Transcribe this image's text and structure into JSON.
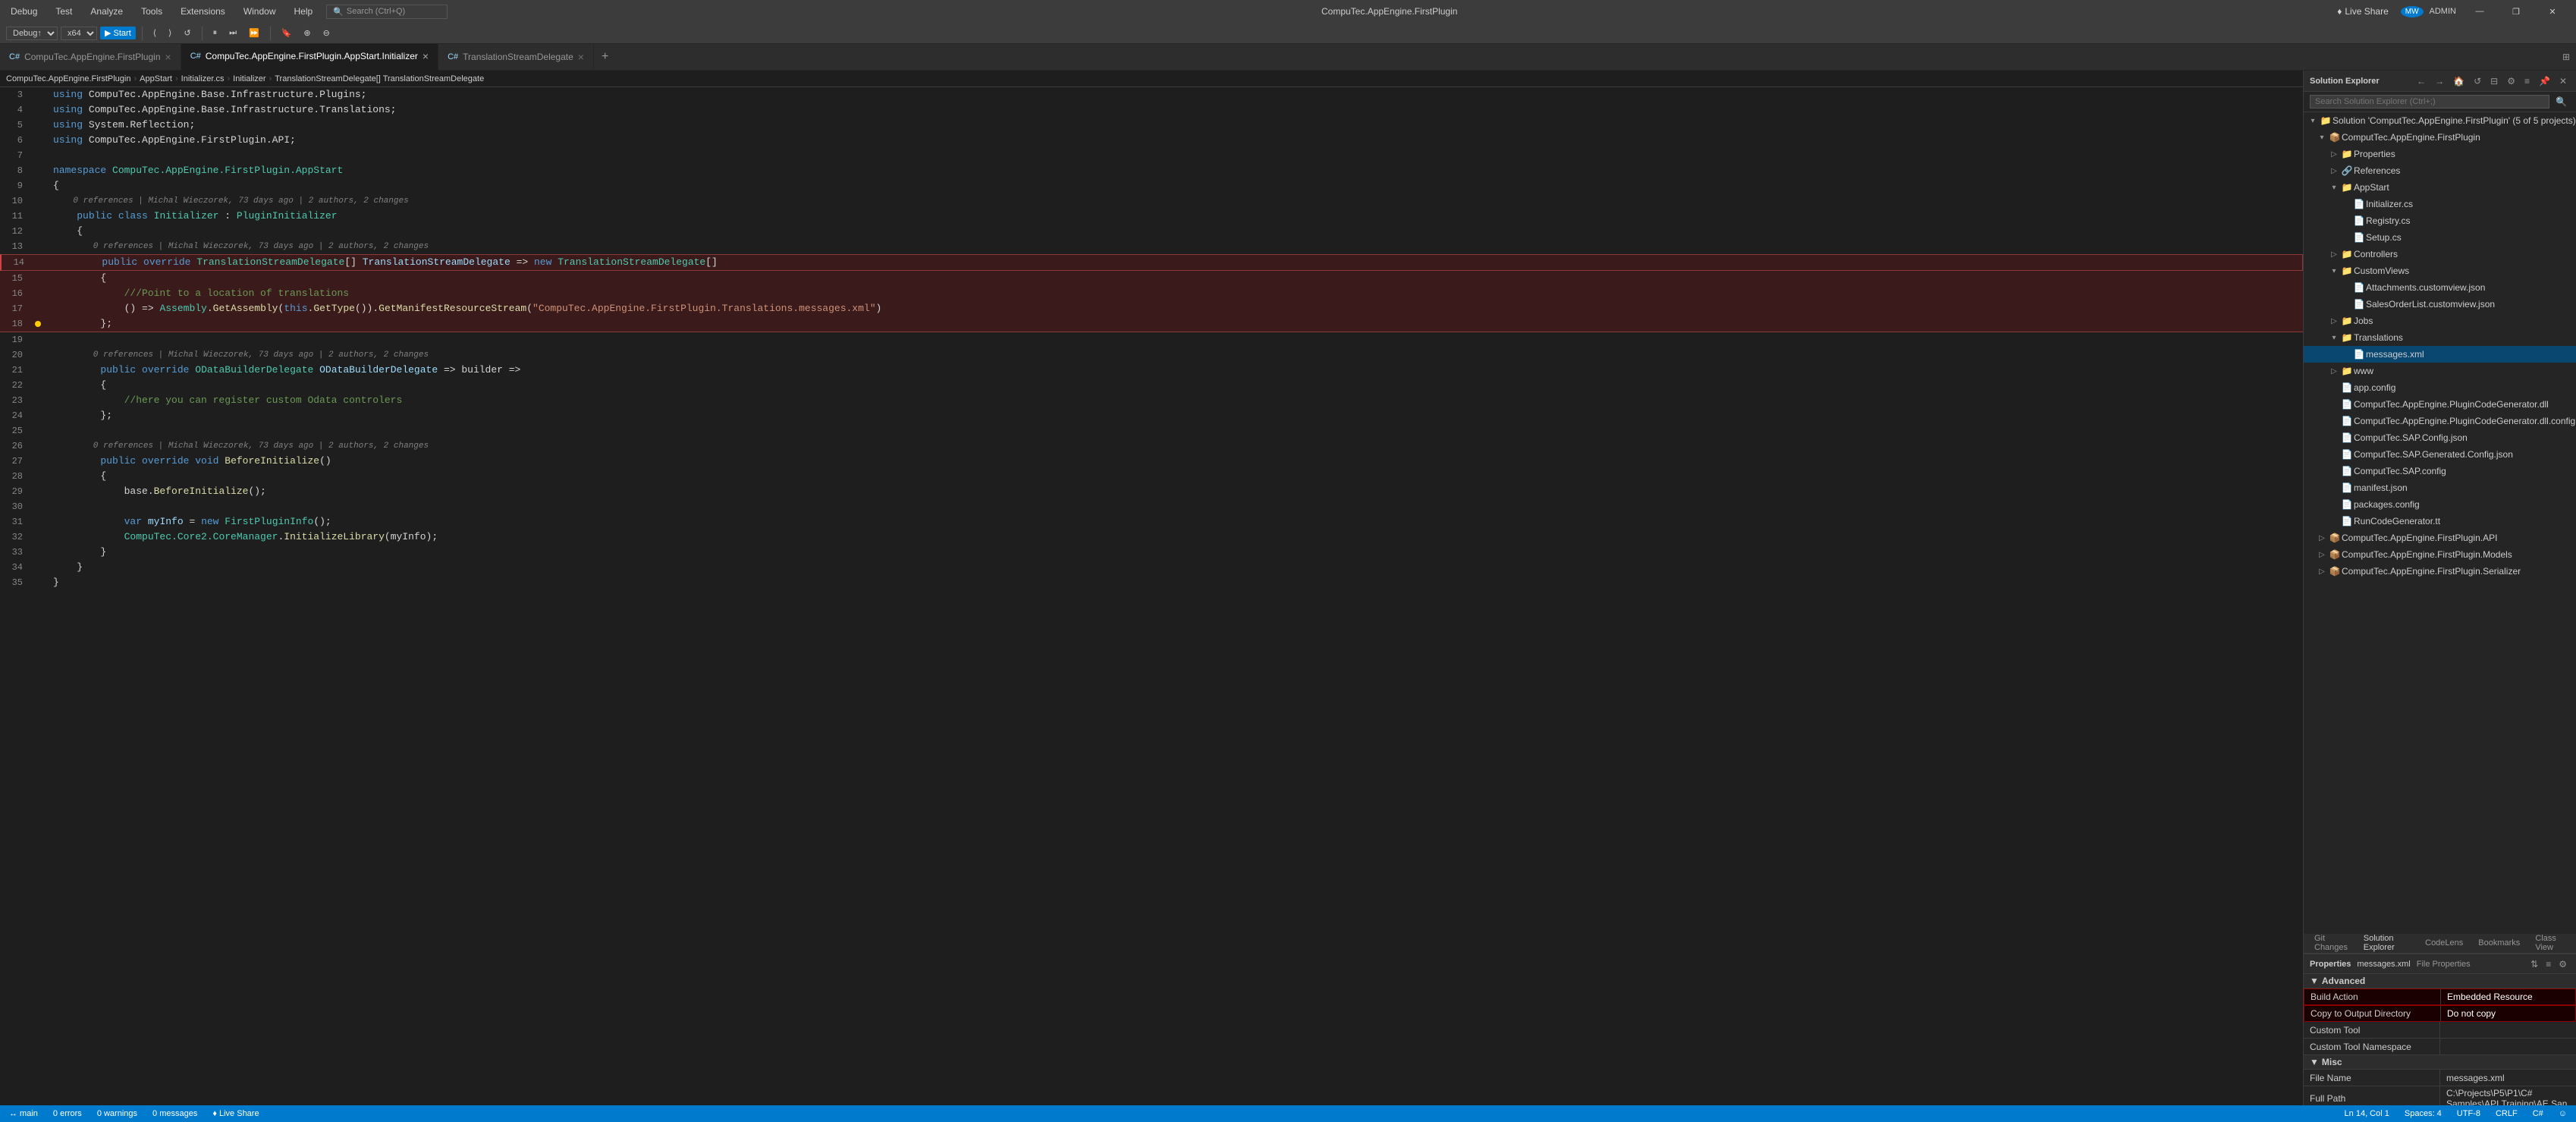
{
  "titleBar": {
    "menus": [
      "Debug",
      "Test",
      "Analyze",
      "Tools",
      "Extensions",
      "Window",
      "Help"
    ],
    "searchPlaceholder": "Search (Ctrl+Q)",
    "centerTitle": "CompuTec.AppEngine.FirstPlugin",
    "userInitials": "MW",
    "adminLabel": "ADMIN",
    "liveShareLabel": "Live Share",
    "winControls": [
      "—",
      "❐",
      "✕"
    ]
  },
  "toolbar": {
    "debugConfig": "Debug↑",
    "platform": "x64",
    "startLabel": "▶ Start",
    "searchPlaceholder": "Search (Ctrl+Q)"
  },
  "tabs": [
    {
      "label": "CompuTec.AppEngine.FirstPlugin",
      "icon": "C#",
      "active": false,
      "closeable": true
    },
    {
      "label": "CompuTec.AppEngine.FirstPlugin.AppStart.Initializer",
      "icon": "C#",
      "active": true,
      "closeable": true
    },
    {
      "label": "TranslationStreamDelegate",
      "icon": "C#",
      "active": false,
      "closeable": true
    }
  ],
  "breadcrumb": {
    "parts": [
      "CompuTec.AppEngine.FirstPlugin",
      "AppStart",
      "Initializer.cs",
      "Initializer",
      "TranslationStreamDelegate[]TranslationStreamDelegate"
    ]
  },
  "codeLines": [
    {
      "num": "3",
      "content": "using CompuTec.AppEngine.Base.Infrastructure.Plugins;",
      "type": "normal"
    },
    {
      "num": "4",
      "content": "using CompuTec.AppEngine.Base.Infrastructure.Translations;",
      "type": "normal"
    },
    {
      "num": "5",
      "content": "using System.Reflection;",
      "type": "normal"
    },
    {
      "num": "6",
      "content": "using CompuTec.AppEngine.FirstPlugin.API;",
      "type": "normal"
    },
    {
      "num": "7",
      "content": "",
      "type": "normal"
    },
    {
      "num": "8",
      "content": "namespace CompuTec.AppEngine.FirstPlugin.AppStart",
      "type": "normal"
    },
    {
      "num": "9",
      "content": "{",
      "type": "normal"
    },
    {
      "num": "10",
      "content": "    0 references | Michal Wieczorek, 73 days ago | 2 authors, 2 changes",
      "type": "refinfo"
    },
    {
      "num": "11",
      "content": "    public class Initializer : PluginInitializer",
      "type": "normal"
    },
    {
      "num": "12",
      "content": "    {",
      "type": "normal"
    },
    {
      "num": "13",
      "content": "        0 references | Michal Wieczorek, 73 days ago | 2 authors, 2 changes",
      "type": "refinfo"
    },
    {
      "num": "14",
      "content": "        public override TranslationStreamDelegate[] TranslationStreamDelegate => new TranslationStreamDelegate[]",
      "type": "highlight"
    },
    {
      "num": "15",
      "content": "        {",
      "type": "highlight"
    },
    {
      "num": "16",
      "content": "            ///Point to a location of translations",
      "type": "highlight_comment"
    },
    {
      "num": "17",
      "content": "            () => Assembly.GetAssembly(this.GetType()).GetManifestResourceStream(\"CompuTec.AppEngine.FirstPlugin.Translations.messages.xml\")",
      "type": "highlight"
    },
    {
      "num": "18",
      "content": "        };",
      "type": "highlight"
    },
    {
      "num": "19",
      "content": "",
      "type": "normal"
    },
    {
      "num": "20",
      "content": "        0 references | Michal Wieczorek, 73 days ago | 2 authors, 2 changes",
      "type": "refinfo"
    },
    {
      "num": "21",
      "content": "        public override ODataBuilderDelegate ODataBuilderDelegate => builder =>",
      "type": "normal"
    },
    {
      "num": "22",
      "content": "        {",
      "type": "normal"
    },
    {
      "num": "23",
      "content": "            //here you can register custom Odata controlers",
      "type": "comment"
    },
    {
      "num": "24",
      "content": "        };",
      "type": "normal"
    },
    {
      "num": "25",
      "content": "",
      "type": "normal"
    },
    {
      "num": "26",
      "content": "        0 references | Michal Wieczorek, 73 days ago | 2 authors, 2 changes",
      "type": "refinfo"
    },
    {
      "num": "27",
      "content": "        public override void BeforeInitialize()",
      "type": "normal"
    },
    {
      "num": "28",
      "content": "        {",
      "type": "normal"
    },
    {
      "num": "29",
      "content": "            base.BeforeInitialize();",
      "type": "normal"
    },
    {
      "num": "30",
      "content": "",
      "type": "normal"
    },
    {
      "num": "31",
      "content": "            var myInfo = new FirstPluginInfo();",
      "type": "normal"
    },
    {
      "num": "32",
      "content": "            CompuTec.Core2.CoreManager.InitializeLibrary(myInfo);",
      "type": "normal"
    },
    {
      "num": "33",
      "content": "        }",
      "type": "normal"
    },
    {
      "num": "34",
      "content": "    }",
      "type": "normal"
    },
    {
      "num": "35",
      "content": "}",
      "type": "normal"
    }
  ],
  "solutionExplorer": {
    "title": "Solution Explorer",
    "searchPlaceholder": "Search Solution Explorer (Ctrl+;)",
    "solutionLabel": "Solution 'ComputTec.AppEngine.FirstPlugin' (5 of 5 projects)",
    "tree": [
      {
        "label": "Solution 'ComputTec.AppEngine.FirstPlugin' (5 of 5 projects)",
        "level": 0,
        "expanded": true,
        "icon": "📁"
      },
      {
        "label": "ComputTec.AppEngine.FirstPlugin",
        "level": 1,
        "expanded": true,
        "icon": "📦"
      },
      {
        "label": "Properties",
        "level": 2,
        "expanded": false,
        "icon": "📁"
      },
      {
        "label": "References",
        "level": 2,
        "expanded": false,
        "icon": "🔗"
      },
      {
        "label": "AppStart",
        "level": 2,
        "expanded": true,
        "icon": "📁"
      },
      {
        "label": "Initializer.cs",
        "level": 3,
        "expanded": false,
        "icon": "📄"
      },
      {
        "label": "Registry.cs",
        "level": 3,
        "expanded": false,
        "icon": "📄"
      },
      {
        "label": "Setup.cs",
        "level": 3,
        "expanded": false,
        "icon": "📄"
      },
      {
        "label": "Controllers",
        "level": 2,
        "expanded": false,
        "icon": "📁"
      },
      {
        "label": "CustomViews",
        "level": 2,
        "expanded": true,
        "icon": "📁"
      },
      {
        "label": "Attachments.customview.json",
        "level": 3,
        "expanded": false,
        "icon": "📄"
      },
      {
        "label": "SalesOrderList.customview.json",
        "level": 3,
        "expanded": false,
        "icon": "📄"
      },
      {
        "label": "Jobs",
        "level": 2,
        "expanded": false,
        "icon": "📁"
      },
      {
        "label": "Translations",
        "level": 2,
        "expanded": true,
        "icon": "📁"
      },
      {
        "label": "messages.xml",
        "level": 3,
        "expanded": false,
        "icon": "📄",
        "selected": true
      },
      {
        "label": "www",
        "level": 2,
        "expanded": false,
        "icon": "📁"
      },
      {
        "label": "app.config",
        "level": 2,
        "expanded": false,
        "icon": "📄"
      },
      {
        "label": "ComputTec.AppEngine.PluginCodeGenerator.dll",
        "level": 2,
        "expanded": false,
        "icon": "📄"
      },
      {
        "label": "ComputTec.AppEngine.PluginCodeGenerator.dll.config",
        "level": 2,
        "expanded": false,
        "icon": "📄"
      },
      {
        "label": "ComputTec.SAP.Config.json",
        "level": 2,
        "expanded": false,
        "icon": "📄"
      },
      {
        "label": "ComputTec.SAP.Generated.Config.json",
        "level": 2,
        "expanded": false,
        "icon": "📄"
      },
      {
        "label": "ComputTec.SAP.config",
        "level": 2,
        "expanded": false,
        "icon": "📄"
      },
      {
        "label": "manifest.json",
        "level": 2,
        "expanded": false,
        "icon": "📄"
      },
      {
        "label": "packages.config",
        "level": 2,
        "expanded": false,
        "icon": "📄"
      },
      {
        "label": "RunCodeGenerator.tt",
        "level": 2,
        "expanded": false,
        "icon": "📄"
      },
      {
        "label": "ComputTec.AppEngine.FirstPlugin.API",
        "level": 1,
        "expanded": false,
        "icon": "📦"
      },
      {
        "label": "ComputTec.AppEngine.FirstPlugin.Models",
        "level": 1,
        "expanded": false,
        "icon": "📦"
      },
      {
        "label": "ComputTec.AppEngine.FirstPlugin.Serializer",
        "level": 1,
        "expanded": false,
        "icon": "📦"
      }
    ]
  },
  "panelTabs": [
    "Git Changes",
    "Solution Explorer",
    "CodeLens",
    "Bookmarks",
    "Class View"
  ],
  "activePanelTab": "Solution Explorer",
  "properties": {
    "title": "Properties",
    "filename": "messages.xml",
    "subtitle": "File Properties",
    "sections": [
      {
        "name": "Advanced",
        "rows": [
          {
            "name": "Build Action",
            "value": "Embedded Resource",
            "highlight": true
          },
          {
            "name": "Copy to Output Directory",
            "value": "Do not copy",
            "highlight": true
          },
          {
            "name": "Custom Tool",
            "value": ""
          },
          {
            "name": "Custom Tool Namespace",
            "value": ""
          }
        ]
      },
      {
        "name": "Misc",
        "rows": [
          {
            "name": "File Name",
            "value": "messages.xml"
          },
          {
            "name": "Full Path",
            "value": "C:\\Projects\\P5\\P1\\C#  Samples\\API Training\\AE San"
          }
        ]
      }
    ]
  },
  "statusBar": {
    "gitBranch": "↔ main",
    "errors": "0 errors",
    "warnings": "0 warnings",
    "messages": "0 messages",
    "liveShare": "♦ Live Share",
    "cursorPos": "Ln 14, Col 1",
    "spaces": "Spaces: 4",
    "encoding": "UTF-8",
    "lineEnding": "CRLF",
    "language": "C#",
    "feedback": "☺"
  }
}
